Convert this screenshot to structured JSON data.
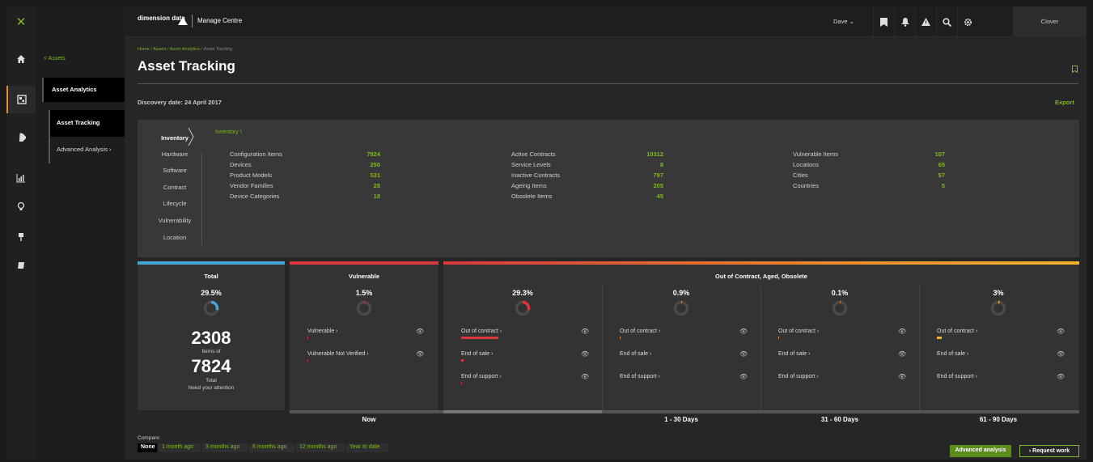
{
  "rail": {
    "close": "✕",
    "icons": [
      "home-icon",
      "dashboard-icon",
      "tag-icon",
      "chart-icon",
      "bulb-icon",
      "pin-icon",
      "book-icon"
    ]
  },
  "subnav": {
    "back": "< Assets",
    "section": "Asset Analytics",
    "items": [
      {
        "label": "Asset Tracking"
      },
      {
        "label": "Advanced Analysis ›"
      }
    ]
  },
  "topbar": {
    "brand": "dimension data",
    "app": "Manage Centre",
    "user": "Dave ⌄",
    "account": "Clover"
  },
  "breadcrumb": {
    "home": "Home",
    "sep1": " / ",
    "assets": "Assets",
    "sep2": " / ",
    "analytics": "Asset Analytics",
    "sep3": " / ",
    "current": "Asset Tracking"
  },
  "page": {
    "title": "Asset Tracking",
    "discovery": "Discovery date: 24 April 2017",
    "export": "Export"
  },
  "tabs": [
    "Inventory",
    "Hardware",
    "Software",
    "Contract",
    "Lifecycle",
    "Vulnerability",
    "Location"
  ],
  "inventory": {
    "crumb": "Inventory \\",
    "col1": [
      {
        "label": "Configuration Items",
        "value": "7824"
      },
      {
        "label": "Devices",
        "value": "250"
      },
      {
        "label": "Product Models",
        "value": "531"
      },
      {
        "label": "Vendor Families",
        "value": "28"
      },
      {
        "label": "Device Categories",
        "value": "18"
      }
    ],
    "col2": [
      {
        "label": "Active Contracts",
        "value": "10312"
      },
      {
        "label": "Service Levels",
        "value": "8"
      },
      {
        "label": "Inactive Contracts",
        "value": "797"
      },
      {
        "label": "Ageing Items",
        "value": "205"
      },
      {
        "label": "Obsolete Items",
        "value": "45"
      }
    ],
    "col3": [
      {
        "label": "Vulnerable Items",
        "value": "107"
      },
      {
        "label": "Locations",
        "value": "65"
      },
      {
        "label": "Cities",
        "value": "57"
      },
      {
        "label": "Countries",
        "value": "5"
      }
    ]
  },
  "total": {
    "heading": "Total",
    "pct": "29.5%",
    "fraction": 0.295,
    "count": "2308",
    "items_of": "Items of",
    "total": "7824",
    "total_label": "Total",
    "attention": "Need your attention"
  },
  "vulnerable": {
    "heading": "Vulnerable",
    "pct": "1.5%",
    "fraction": 0.015,
    "rows": [
      "Vulnerable ›",
      "Vulnerable Not Verified ›"
    ]
  },
  "contract": {
    "heading": "Out of Contract, Aged, Obsolete",
    "cols": [
      {
        "pct": "29.3%",
        "fraction": 0.293,
        "color": "#d9363e"
      },
      {
        "pct": "0.9%",
        "fraction": 0.009,
        "color": "#e98a2f"
      },
      {
        "pct": "0.1%",
        "fraction": 0.001,
        "color": "#e98a2f"
      },
      {
        "pct": "3%",
        "fraction": 0.03,
        "color": "#f3b32c"
      }
    ],
    "rows": [
      "Out of contract ›",
      "End of sale ›",
      "End of support ›"
    ]
  },
  "periods": [
    "Now",
    "1 - 30 Days",
    "31 - 60 Days",
    "61 - 90 Days"
  ],
  "compare": {
    "label": "Compare:",
    "options": [
      "None",
      "1 month ago",
      "3 months ago",
      "6 months ago",
      "12 months ago",
      "Year to date"
    ]
  },
  "actions": {
    "advanced": "Advanced analysis",
    "request": "› Request work"
  },
  "colors": {
    "accent": "#7fb62b",
    "blue": "#4aa3d8",
    "red": "#d9363e",
    "orange": "#e98a2f"
  }
}
